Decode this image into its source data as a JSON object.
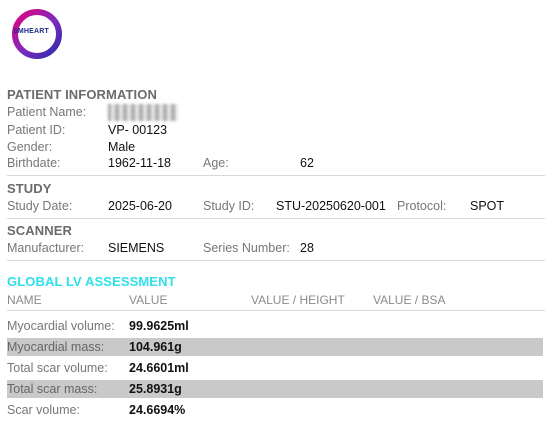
{
  "logo": {
    "text": "SMHEART",
    "ring_colors": [
      "#e4007f",
      "#7b2cbf",
      "#2b2ba8"
    ]
  },
  "patient": {
    "title": "PATIENT INFORMATION",
    "name_label": "Patient Name:",
    "id_label": "Patient ID:",
    "id_value": "VP- 00123",
    "gender_label": "Gender:",
    "gender_value": "Male",
    "birthdate_label": "Birthdate:",
    "birthdate_value": "1962-11-18",
    "age_label": "Age:",
    "age_value": "62"
  },
  "study": {
    "title": "STUDY",
    "date_label": "Study Date:",
    "date_value": "2025-06-20",
    "id_label": "Study ID:",
    "id_value": "STU-20250620-001",
    "protocol_label": "Protocol:",
    "protocol_value": "SPOT"
  },
  "scanner": {
    "title": "SCANNER",
    "manufacturer_label": "Manufacturer:",
    "manufacturer_value": "SIEMENS",
    "series_label": "Series Number:",
    "series_value": "28"
  },
  "lv": {
    "title": "GLOBAL LV ASSESSMENT",
    "title_color": "#2ee0ea",
    "headers": [
      "NAME",
      "VALUE",
      "VALUE / HEIGHT",
      "VALUE / BSA"
    ],
    "rows": [
      {
        "label": "Myocardial volume:",
        "value": "99.9625ml"
      },
      {
        "label": "Myocardial mass:",
        "value": "104.961g"
      },
      {
        "label": "Total scar volume:",
        "value": "24.6601ml"
      },
      {
        "label": "Total scar mass:",
        "value": "25.8931g"
      },
      {
        "label": "Scar volume:",
        "value": "24.6694%"
      }
    ]
  }
}
